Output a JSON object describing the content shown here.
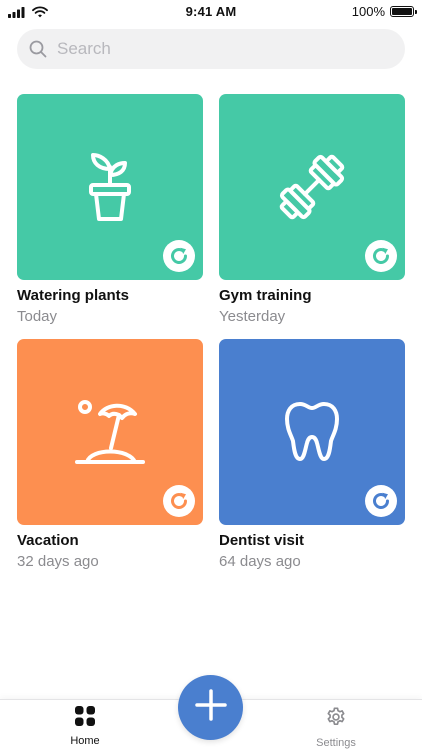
{
  "status_bar": {
    "time": "9:41 AM",
    "battery": "100%"
  },
  "search": {
    "placeholder": "Search"
  },
  "cards": [
    {
      "title": "Watering plants",
      "subtitle": "Today",
      "color": "#45c9a6",
      "icon": "plant-pot-icon"
    },
    {
      "title": "Gym training",
      "subtitle": "Yesterday",
      "color": "#45c9a6",
      "icon": "dumbbell-icon"
    },
    {
      "title": "Vacation",
      "subtitle": "32 days ago",
      "color": "#fd8f50",
      "icon": "beach-umbrella-icon"
    },
    {
      "title": "Dentist visit",
      "subtitle": "64 days ago",
      "color": "#4a7fcf",
      "icon": "tooth-icon"
    }
  ],
  "tab_bar": {
    "home_label": "Home",
    "settings_label": "Settings",
    "active": "Home"
  },
  "colors": {
    "teal": "#45c9a6",
    "orange": "#fd8f50",
    "blue": "#4a7fcf"
  }
}
